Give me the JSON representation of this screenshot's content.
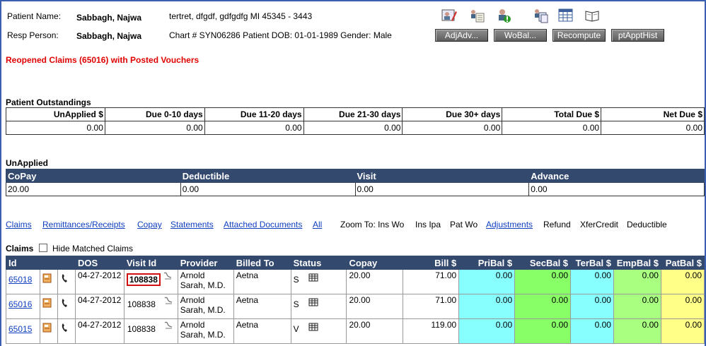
{
  "header": {
    "patient_name_label": "Patient Name:",
    "patient_name": "Sabbagh, Najwa",
    "address": "tertret, dfgdf, gdfgdfg MI 45345 - 3443",
    "resp_person_label": "Resp Person:",
    "resp_person": "Sabbagh, Najwa",
    "chart_line": "Chart # SYN06286 Patient DOB: 01-01-1989 Gender: Male",
    "buttons": {
      "adjadv": "AdjAdv...",
      "wobal": "WoBal...",
      "recompute": "Recompute",
      "ptappthist": "ptApptHist"
    },
    "icons": [
      "patient-edit-icon",
      "notes-icon",
      "patient-alert-icon",
      "documents-icon",
      "grid-icon",
      "book-icon"
    ]
  },
  "alert": "Reopened Claims (65016) with Posted Vouchers",
  "outstandings": {
    "title": "Patient Outstandings",
    "headers": [
      "UnApplied $",
      "Due 0-10 days",
      "Due 11-20 days",
      "Due 21-30 days",
      "Due 30+ days",
      "Total Due $",
      "Net Due $"
    ],
    "values": [
      "0.00",
      "0.00",
      "0.00",
      "0.00",
      "0.00",
      "0.00",
      "0.00"
    ]
  },
  "unapplied": {
    "title": "UnApplied",
    "headers": [
      "CoPay",
      "Deductible",
      "Visit",
      "Advance"
    ],
    "values": [
      "20.00",
      "0.00",
      "0.00",
      "0.00"
    ]
  },
  "nav": {
    "links": [
      "Claims",
      "Remittances/Receipts",
      "Copay",
      "Statements",
      "Attached Documents",
      "All"
    ],
    "zoom_label": "Zoom To: Ins Wo",
    "ins_ipa": "Ins Ipa",
    "pat_wo": "Pat Wo",
    "adjustments": "Adjustments",
    "refund": "Refund",
    "xfercredit": "XferCredit",
    "deductible": "Deductible"
  },
  "claims": {
    "title": "Claims",
    "hide_matched": "Hide Matched Claims",
    "headers": [
      "Id",
      "",
      "",
      "DOS",
      "Visit Id",
      "Provider",
      "Billed To",
      "Status",
      "Copay",
      "Bill $",
      "PriBal $",
      "SecBal $",
      "TerBal $",
      "EmpBal $",
      "PatBal $"
    ],
    "rows": [
      {
        "id": "65018",
        "dos": "04-27-2012",
        "visit": "108838",
        "provider": "Arnold Sarah, M.D.",
        "billed_to": "Aetna",
        "status": "S",
        "copay": "20.00",
        "bill": "71.00",
        "pri": "0.00",
        "sec": "0.00",
        "ter": "0.00",
        "emp": "0.00",
        "pat": "0.00"
      },
      {
        "id": "65016",
        "dos": "04-27-2012",
        "visit": "108838",
        "provider": "Arnold Sarah, M.D.",
        "billed_to": "Aetna",
        "status": "S",
        "copay": "20.00",
        "bill": "71.00",
        "pri": "0.00",
        "sec": "0.00",
        "ter": "0.00",
        "emp": "0.00",
        "pat": "0.00"
      },
      {
        "id": "65015",
        "dos": "04-27-2012",
        "visit": "108838",
        "provider": "Arnold Sarah, M.D.",
        "billed_to": "Aetna",
        "status": "V",
        "copay": "20.00",
        "bill": "119.00",
        "pri": "0.00",
        "sec": "0.00",
        "ter": "0.00",
        "emp": "0.00",
        "pat": "0.00"
      }
    ]
  },
  "colors": {
    "header_bg": "#34496e",
    "pri_bal": "#88ffff",
    "sec_bal": "#88ff66",
    "ter_bal": "#88ffff",
    "emp_bal": "#a8ff80",
    "pat_bal": "#ffff88",
    "alert": "#e00000",
    "link": "#1040c0"
  }
}
